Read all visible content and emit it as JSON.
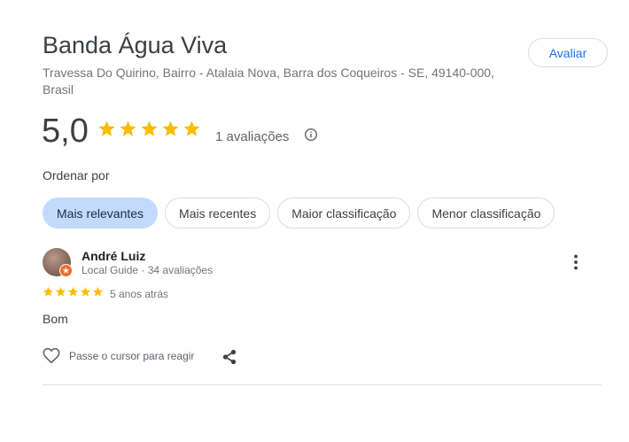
{
  "place": {
    "name": "Banda Água Viva",
    "address": "Travessa Do Quirino, Bairro - Atalaia Nova, Barra dos Coqueiros - SE, 49140-000, Brasil",
    "rate_button": "Avaliar"
  },
  "summary": {
    "score": "5,0",
    "star_rating": 5,
    "review_count": "1 avaliações"
  },
  "sort": {
    "label": "Ordenar por",
    "chips": [
      "Mais relevantes",
      "Mais recentes",
      "Maior classificação",
      "Menor classificação"
    ],
    "selected": "Mais relevantes"
  },
  "review": {
    "author": "André Luiz",
    "meta": "Local Guide · 34 avaliações",
    "star_rating": 5,
    "time": "5 anos atrás",
    "text": "Bom",
    "react_label": "Passe o cursor para reagir"
  },
  "colors": {
    "star": "#fbbc04",
    "accent": "#1a73e8",
    "chip_selected_bg": "#c2dbfd",
    "guide_badge": "#f16e2a"
  },
  "icons": {
    "info": "info-icon",
    "more": "more-vert-icon",
    "heart": "heart-icon",
    "share": "share-icon"
  }
}
